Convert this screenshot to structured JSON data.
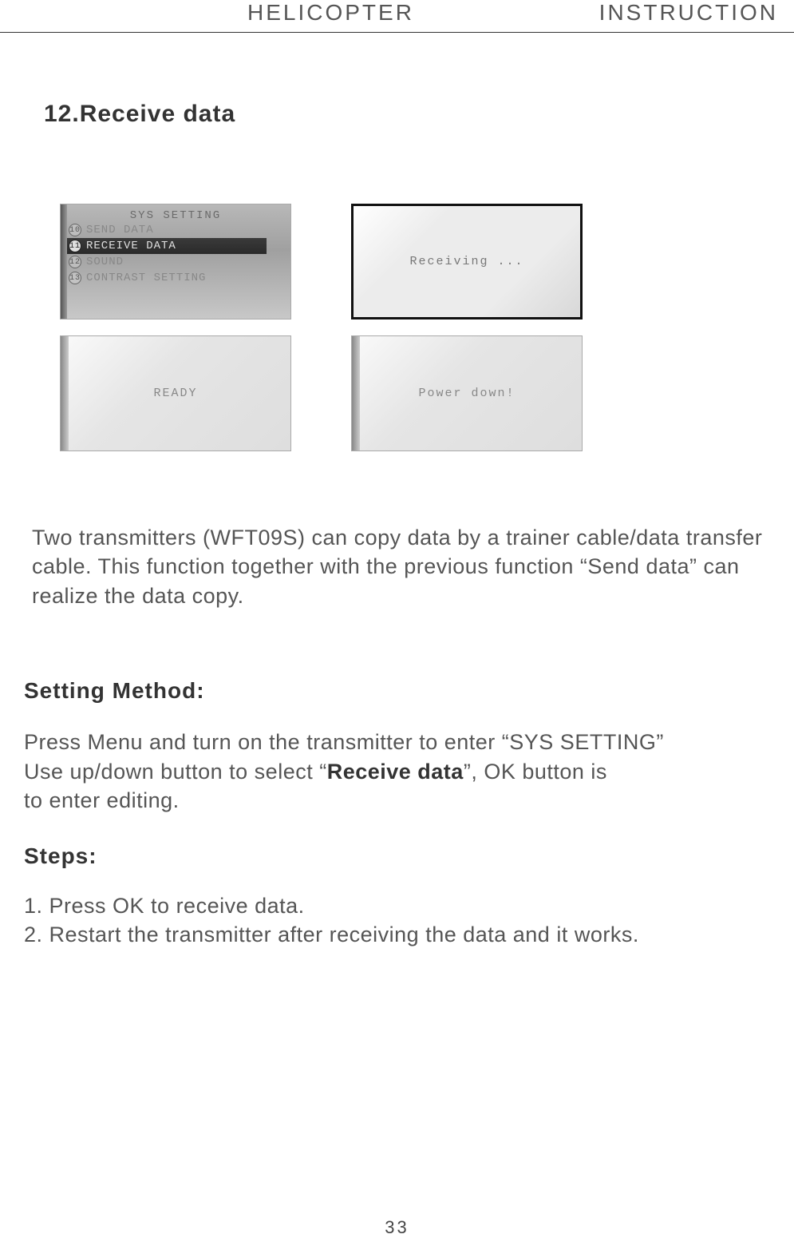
{
  "header": {
    "left": "HELICOPTER",
    "right": "INSTRUCTION"
  },
  "section_title": "12.Receive data",
  "screens": {
    "menu": {
      "title": "SYS SETTING",
      "rows": [
        {
          "num": "10",
          "label": "SEND DATA"
        },
        {
          "num": "11",
          "label": "RECEIVE DATA"
        },
        {
          "num": "12",
          "label": "SOUND"
        },
        {
          "num": "13",
          "label": "CONTRAST SETTING"
        }
      ],
      "selected_index": 1
    },
    "receiving": "Receiving ...",
    "ready": "READY",
    "powerdown": "Power down!"
  },
  "intro": "Two transmitters (WFT09S) can copy data by a trainer cable/data transfer cable. This function together with the previous function “Send data” can realize the data copy.",
  "method": {
    "head": "Setting Method:",
    "line1a": "Press Menu and turn on the transmitter to enter “SYS SETTING”",
    "line2a": "Use up/down button to select “",
    "line2bold": "Receive data",
    "line2b": "”, OK button is",
    "line3": "to enter editing."
  },
  "steps": {
    "head": "Steps:",
    "s1": "1. Press OK to receive data.",
    "s2": "2. Restart the transmitter after receiving the data and it works."
  },
  "page_number": "33"
}
